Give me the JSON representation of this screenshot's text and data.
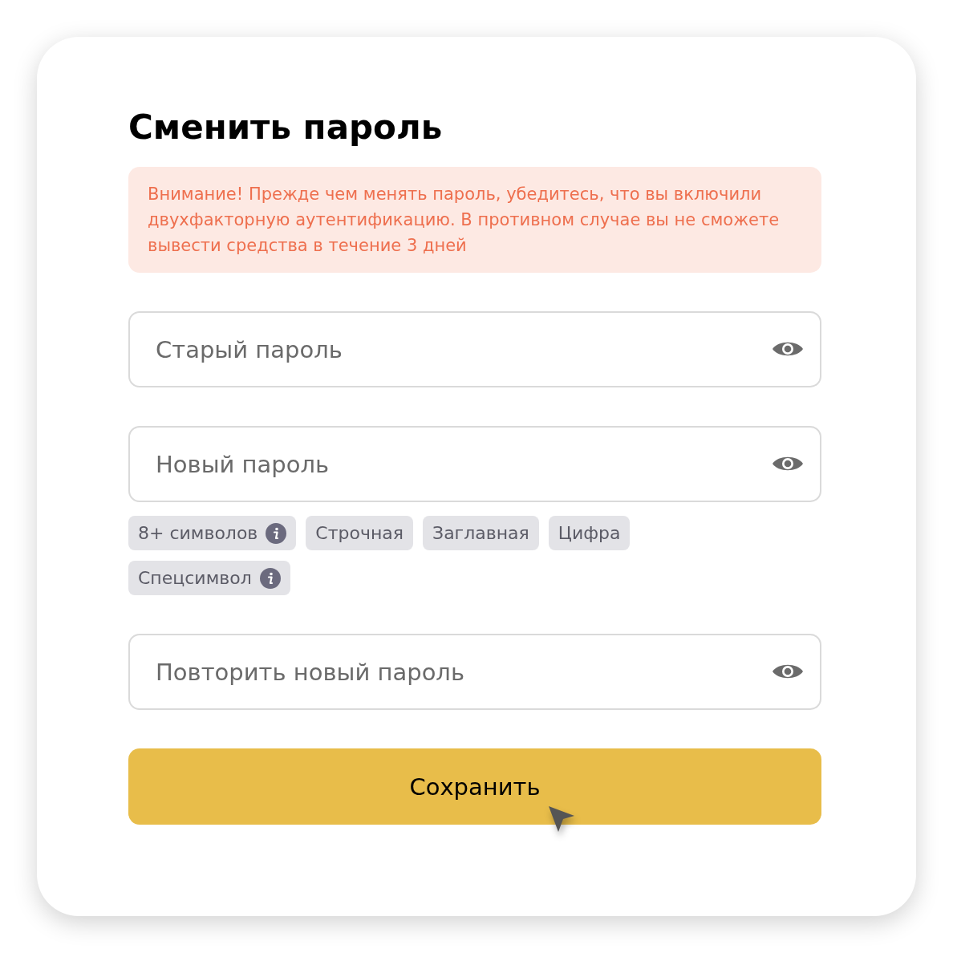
{
  "title": "Сменить пароль",
  "warning": "Внимание! Прежде чем менять пароль, убедитесь, что вы включили двухфакторную аутентификацию. В противном случае вы не сможете вывести средства в течение 3 дней",
  "fields": [
    {
      "placeholder": "Старый пароль"
    },
    {
      "placeholder": "Новый пароль",
      "requirements": [
        {
          "label": "8+ символов",
          "info": true
        },
        {
          "label": "Строчная",
          "info": false
        },
        {
          "label": "Заглавная",
          "info": false
        },
        {
          "label": "Цифра",
          "info": false
        },
        {
          "label": "Спецсимвол",
          "info": true
        }
      ]
    },
    {
      "placeholder": "Повторить новый пароль"
    }
  ],
  "save_button": "Сохранить"
}
